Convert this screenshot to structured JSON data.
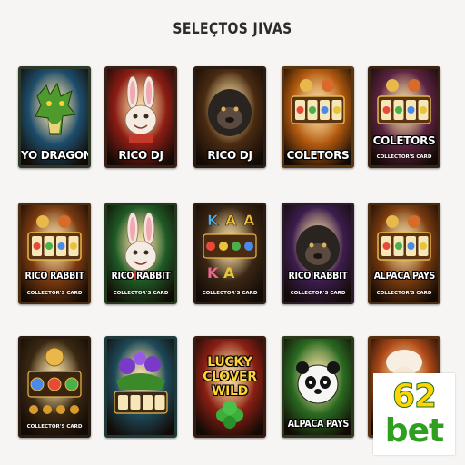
{
  "page": {
    "title": "SELEÇTOS JIVAS"
  },
  "cards": [
    {
      "label": "YO DRAGON",
      "sub": "",
      "icon": "dragon-icon",
      "accent": "#1d4d6b",
      "border": "#2d3a2a"
    },
    {
      "label": "RICO DJ",
      "sub": "",
      "icon": "rabbit-icon",
      "accent": "#8c1d15",
      "border": "#3a2014"
    },
    {
      "label": "RICO DJ",
      "sub": "",
      "icon": "gorilla-icon",
      "accent": "#4a2b12",
      "border": "#2a1c10"
    },
    {
      "label": "COLETORS",
      "sub": "",
      "icon": "slot-reels-icon",
      "accent": "#b35a0f",
      "border": "#5a3610"
    },
    {
      "label": "COLETORS",
      "sub": "COLLECTOR'S CARD",
      "icon": "slot-reels-icon",
      "accent": "#5b2340",
      "border": "#3a2314"
    },
    {
      "label": "RICO RABBIT",
      "sub": "COLLECTOR'S CARD",
      "icon": "slot-reels-icon",
      "accent": "#7a3a10",
      "border": "#4a2c10"
    },
    {
      "label": "RICO RABBIT",
      "sub": "COLLECTOR'S CARD",
      "icon": "rabbit-icon",
      "accent": "#1f5a26",
      "border": "#243a1e"
    },
    {
      "label": "",
      "sub": "COLLECTOR'S CARD",
      "icon": "card-symbols-icon",
      "accent": "#3a2614",
      "border": "#2a1c10"
    },
    {
      "label": "RICO RABBIT",
      "sub": "COLLECTOR'S CARD",
      "icon": "gorilla-icon",
      "accent": "#3c1d4e",
      "border": "#2a1c2a"
    },
    {
      "label": "ALPACA PAYS",
      "sub": "COLLECTOR'S CARD",
      "icon": "slot-reels-icon",
      "accent": "#7a3c10",
      "border": "#4a2c10"
    },
    {
      "label": "",
      "sub": "COLLECTOR'S CARD",
      "icon": "coins-icon",
      "accent": "#3a2812",
      "border": "#2a1c10"
    },
    {
      "label": "",
      "sub": "",
      "icon": "flowers-icon",
      "accent": "#1e4a5a",
      "border": "#1e3a3a"
    },
    {
      "label": "LUCKY CLOVER WILD",
      "sub": "",
      "icon": "clover-icon",
      "accent": "#8a1f14",
      "border": "#3a1a10"
    },
    {
      "label": "ALPACA PAYS",
      "sub": "",
      "icon": "panda-icon",
      "accent": "#2a6a22",
      "border": "#2a3a1a"
    },
    {
      "label": "",
      "sub": "",
      "icon": "alpaca-icon",
      "accent": "#b04a18",
      "border": "#5a3010"
    }
  ],
  "badge": {
    "number": "62",
    "word": "bet",
    "number_color": "#ffd400",
    "word_color": "#2e9f1e"
  }
}
